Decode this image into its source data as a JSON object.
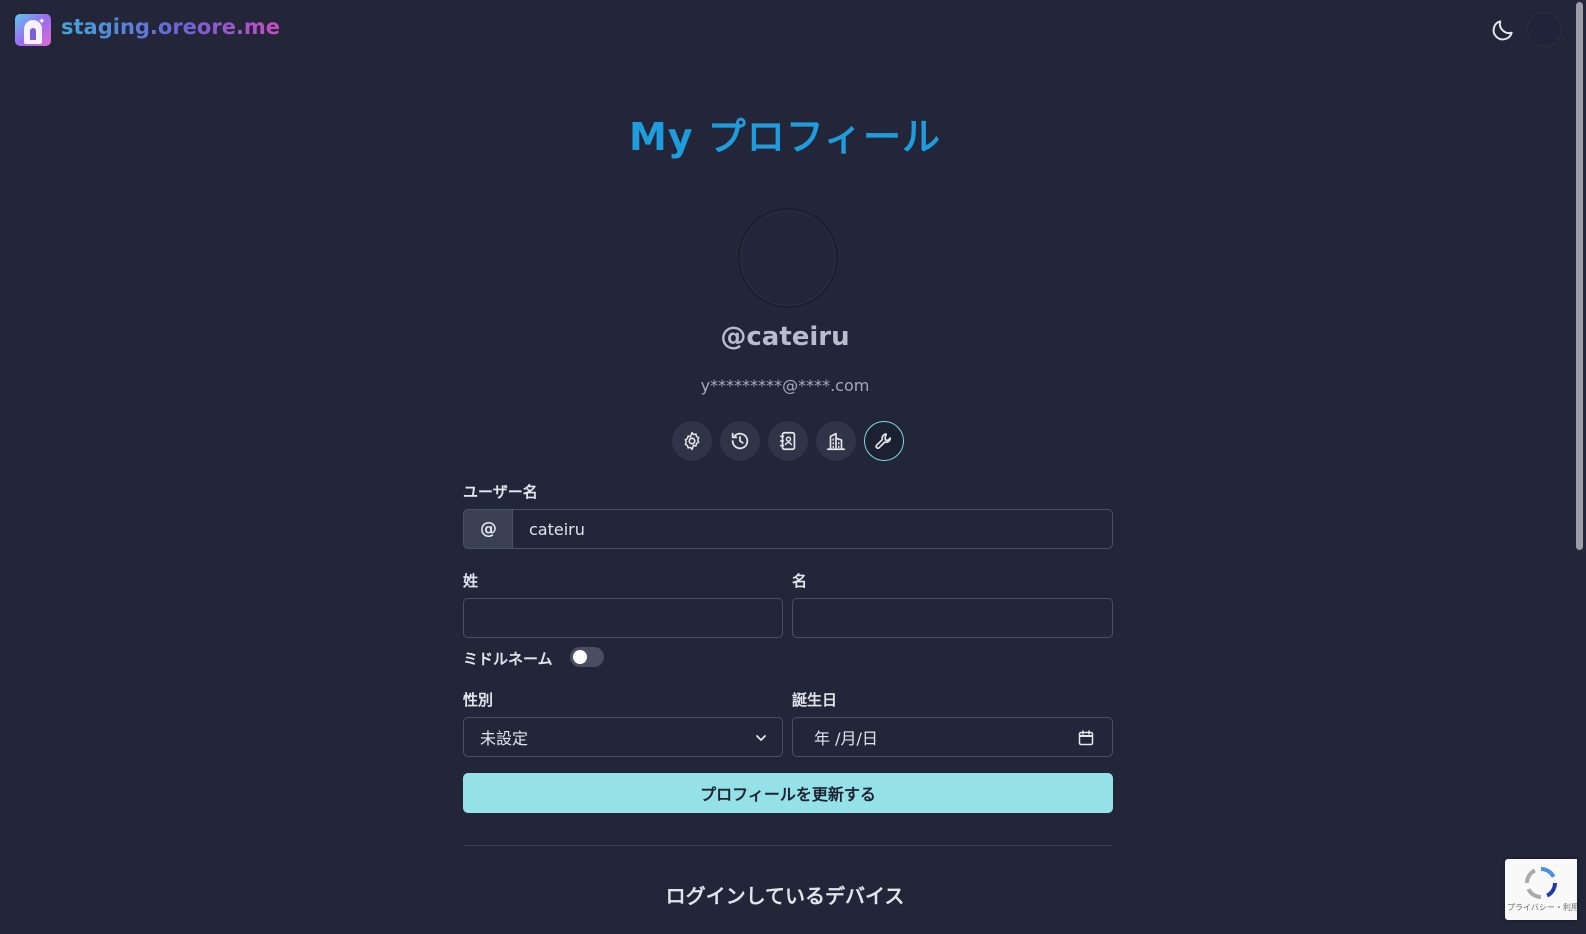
{
  "header": {
    "brand": "staging.oreore.me",
    "logo_icon": "keyhole-door-logo",
    "theme_icon": "moon-icon"
  },
  "profile": {
    "title": "My プロフィール",
    "username_display": "@cateiru",
    "email_display": "y*********@****.com"
  },
  "tabs": [
    {
      "icon": "gear-icon",
      "active": false
    },
    {
      "icon": "history-icon",
      "active": false
    },
    {
      "icon": "contact-book-icon",
      "active": false
    },
    {
      "icon": "building-icon",
      "active": false
    },
    {
      "icon": "wrench-icon",
      "active": true
    }
  ],
  "form": {
    "username_label": "ユーザー名",
    "username_prefix": "@",
    "username_value": "cateiru",
    "family_name_label": "姓",
    "family_name_value": "",
    "given_name_label": "名",
    "given_name_value": "",
    "middle_name_label": "ミドルネーム",
    "middle_name_enabled": false,
    "gender_label": "性別",
    "gender_value": "未設定",
    "birthday_label": "誕生日",
    "birthday_placeholder": "年 /月/日",
    "submit_label": "プロフィールを更新する"
  },
  "devices": {
    "heading": "ログインしているデバイス"
  },
  "recaptcha": {
    "text": "プライバシー・利用規約"
  },
  "colors": {
    "background": "#232638",
    "title": "#1f9cdc",
    "primary_button": "#95e1e8",
    "active_tab_border": "#79d9e2"
  }
}
